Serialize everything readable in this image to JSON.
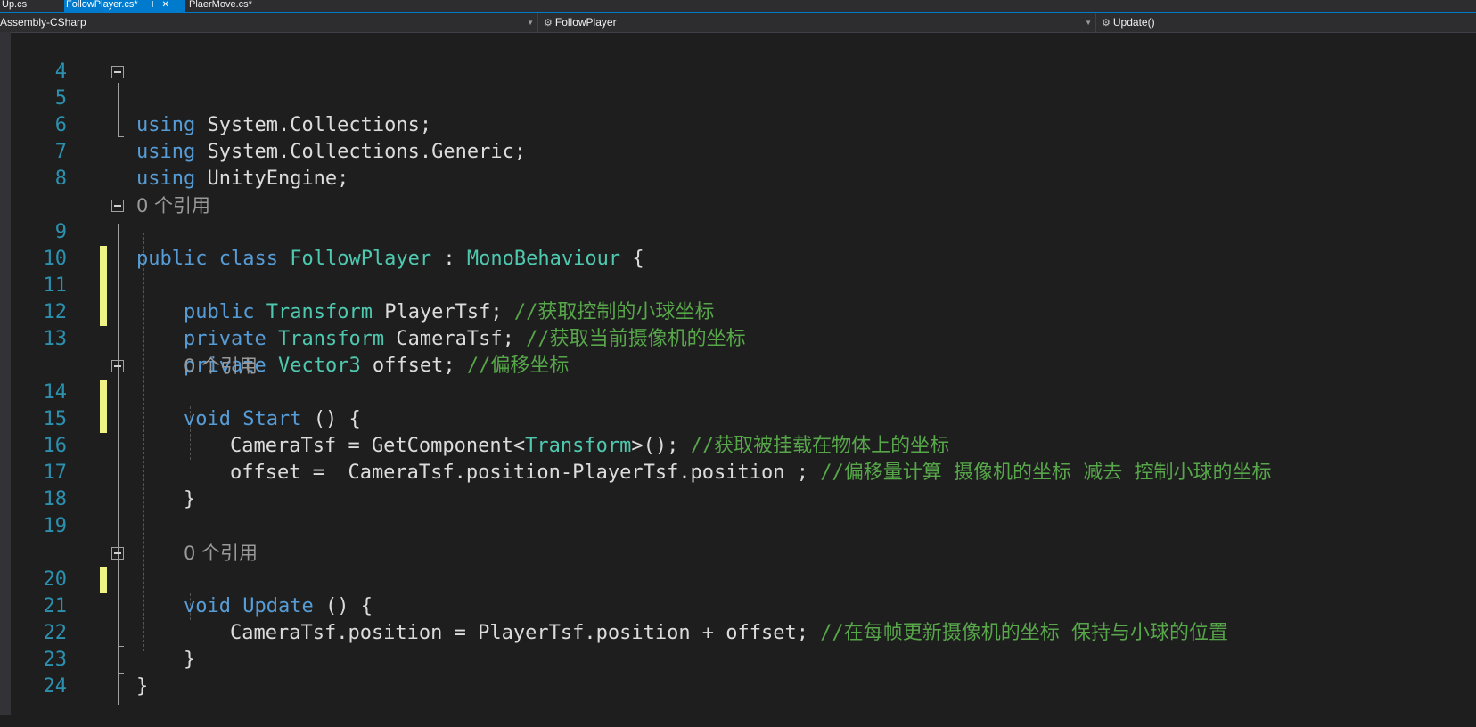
{
  "tabs": [
    {
      "label": "Up.cs",
      "active": false
    },
    {
      "label": "FollowPlayer.cs*",
      "active": true,
      "pin_icon": "pin-icon",
      "close_icon": "close-icon"
    },
    {
      "label": "PlaerMove.cs*",
      "active": false
    }
  ],
  "nav": {
    "project": "Assembly-CSharp",
    "type": "FollowPlayer",
    "member": "Update()",
    "type_icon": "class-icon",
    "member_icon": "method-icon"
  },
  "colors": {
    "background": "#1e1e1e",
    "line_number": "#2b91af",
    "keyword": "#569cd6",
    "type": "#4ec9b0",
    "comment": "#57a64a",
    "plain": "#dcdcdc",
    "codelens": "#999999",
    "change_marker": "#eff284",
    "accent": "#007acc"
  },
  "lines": {
    "l4": {
      "num": "4"
    },
    "l5": {
      "num": "5",
      "kw": "using",
      "rest": " System.Collections;"
    },
    "l6": {
      "num": "6",
      "kw": "using",
      "rest": " System.Collections.Generic;"
    },
    "l7": {
      "num": "7",
      "kw": "using",
      "rest": " UnityEngine;"
    },
    "l8": {
      "num": "8"
    },
    "ref_class": "0 个引用",
    "l9": {
      "num": "9",
      "kw1": "public",
      "kw2": "class",
      "name": "FollowPlayer",
      "colon": " : ",
      "base": "MonoBehaviour",
      "brace": " {"
    },
    "l10": {
      "num": "10"
    },
    "l11": {
      "num": "11",
      "kw": "public",
      "type": "Transform",
      "rest": " PlayerTsf; ",
      "comment": "//获取控制的小球坐标"
    },
    "l12": {
      "num": "12",
      "kw": "private",
      "type": "Transform",
      "rest": " CameraTsf; ",
      "comment": "//获取当前摄像机的坐标"
    },
    "l13": {
      "num": "13",
      "kw": "private",
      "type": "Vector3",
      "rest": " offset; ",
      "comment": "//偏移坐标"
    },
    "ref_start": "0 个引用",
    "l14": {
      "num": "14",
      "kw": "void",
      "name": "Start",
      "rest": " () {"
    },
    "l15": {
      "num": "15",
      "pre": "CameraTsf = GetComponent<",
      "type": "Transform",
      "post": ">(); ",
      "comment": "//获取被挂载在物体上的坐标"
    },
    "l16": {
      "num": "16",
      "code": "offset =  CameraTsf.position-PlayerTsf.position ; ",
      "comment": "//偏移量计算 摄像机的坐标 减去 控制小球的坐标"
    },
    "l17": {
      "num": "17",
      "code": "}"
    },
    "l18": {
      "num": "18"
    },
    "l19": {
      "num": "19"
    },
    "ref_update": "0 个引用",
    "l20": {
      "num": "20",
      "kw": "void",
      "name": "Update",
      "rest": " () {"
    },
    "l21": {
      "num": "21",
      "code": "CameraTsf.position = PlayerTsf.position + offset; ",
      "comment": "//在每帧更新摄像机的坐标 保持与小球的位置"
    },
    "l22": {
      "num": "22",
      "code": "}"
    },
    "l23": {
      "num": "23",
      "code": "}"
    },
    "l24": {
      "num": "24"
    }
  }
}
